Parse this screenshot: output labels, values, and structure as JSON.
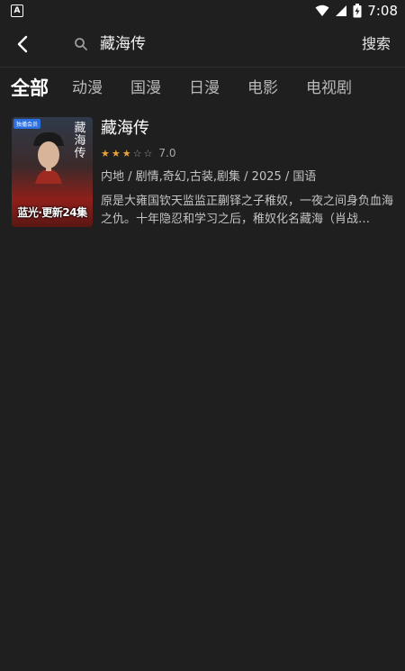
{
  "status_bar": {
    "time": "7:08",
    "app_icon_letter": "A",
    "icons": [
      "wifi-icon",
      "signal-icon",
      "battery-icon"
    ]
  },
  "topbar": {
    "back_icon": "chevron-left-icon",
    "search_icon": "search-icon",
    "query": "藏海传",
    "search_button": "搜索"
  },
  "tabs": [
    {
      "label": "全部",
      "active": true
    },
    {
      "label": "动漫",
      "active": false
    },
    {
      "label": "国漫",
      "active": false
    },
    {
      "label": "日漫",
      "active": false
    },
    {
      "label": "电影",
      "active": false
    },
    {
      "label": "电视剧",
      "active": false
    }
  ],
  "results": [
    {
      "title": "藏海传",
      "rating_stars": 3,
      "rating_max": 5,
      "score": "7.0",
      "meta": "内地 / 剧情,奇幻,古装,剧集 / 2025 / 国语",
      "description": "原是大雍国钦天监监正蒯铎之子稚奴，一夜之间身负血海之仇。十年隐忍和学习之后，稚奴化名藏海（肖战…",
      "poster": {
        "badge": "独播会员",
        "calligraphy": "藏海传",
        "caption": "蓝光·更新24集"
      }
    }
  ],
  "colors": {
    "background": "#1f1f1f",
    "star_filled": "#e8a33a",
    "star_empty": "#9a9a9a",
    "poster_red": "#8e1f1a"
  }
}
